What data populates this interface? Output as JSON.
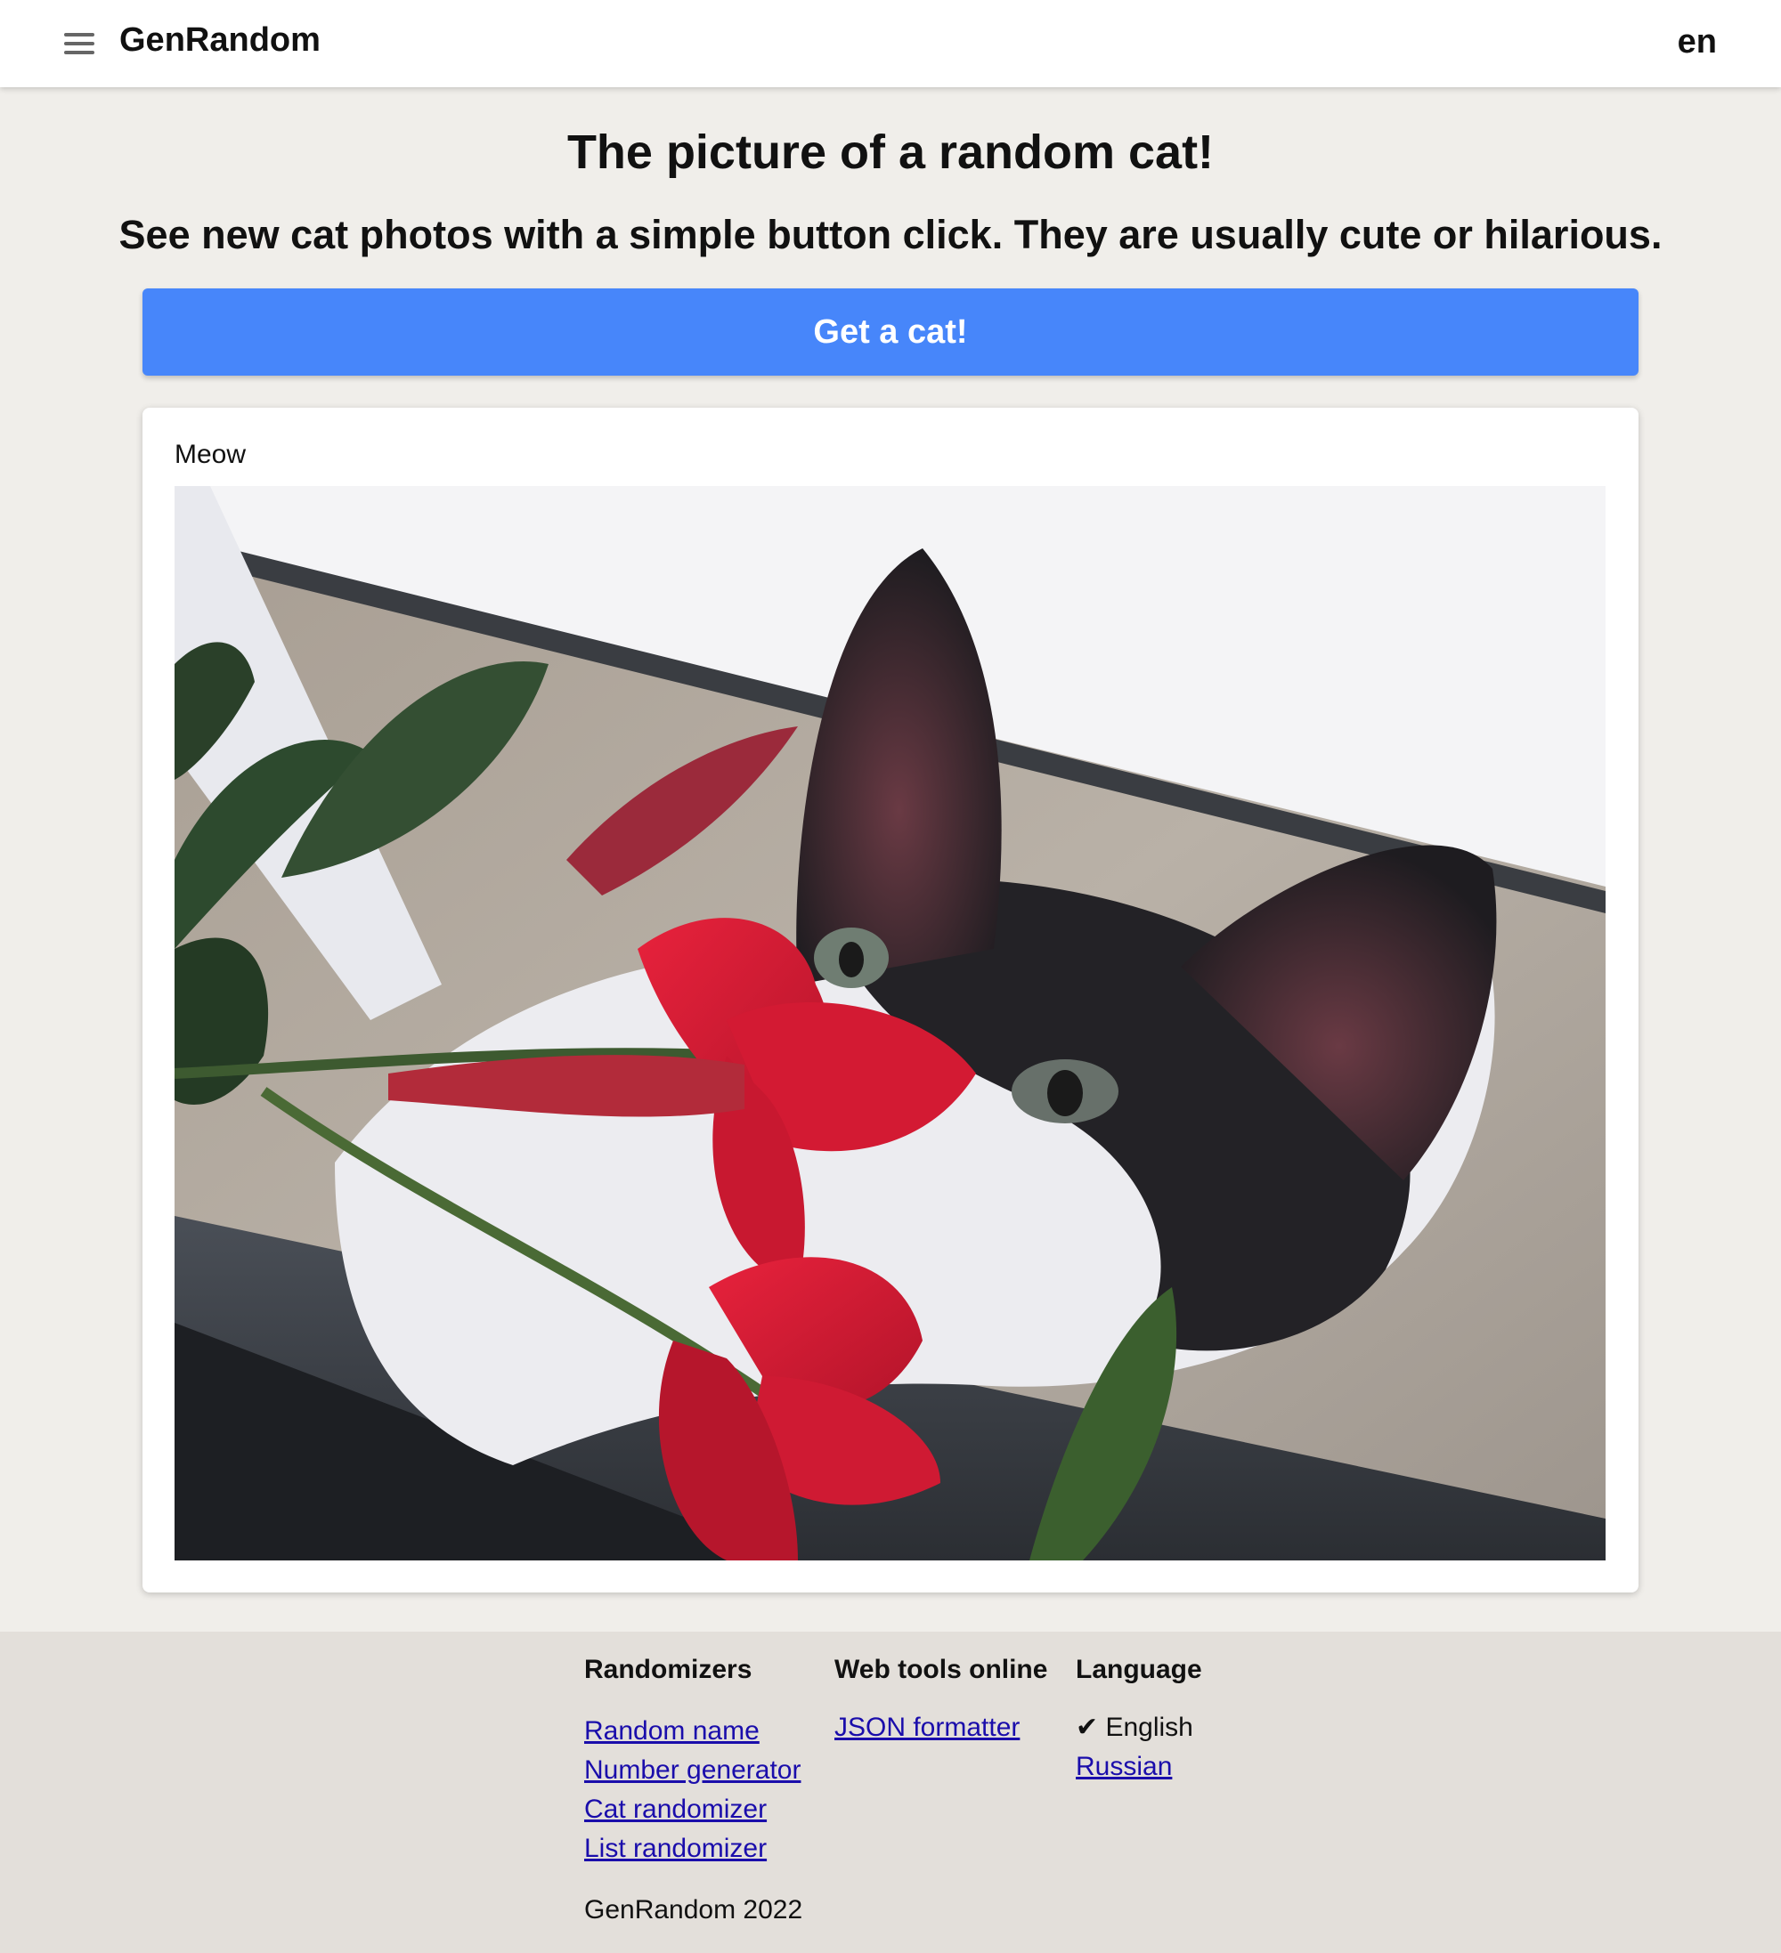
{
  "header": {
    "brand": "GenRandom",
    "language_code": "en"
  },
  "main": {
    "title": "The picture of a random cat!",
    "subtitle": "See new cat photos with a simple button click. They are usually cute or hilarious.",
    "cta_label": "Get a cat!",
    "card": {
      "caption": "Meow",
      "image_alt": "Black and white cat peeking behind red flowers"
    },
    "accent_color": "#4786fa"
  },
  "footer": {
    "randomizers": {
      "heading": "Randomizers",
      "links": [
        "Random name",
        "Number generator",
        "Cat randomizer",
        "List randomizer"
      ]
    },
    "web_tools": {
      "heading": "Web tools online",
      "links": [
        "JSON formatter"
      ]
    },
    "language": {
      "heading": "Language",
      "current": "✔ English",
      "links": [
        "Russian"
      ]
    },
    "copyright": "GenRandom 2022"
  }
}
